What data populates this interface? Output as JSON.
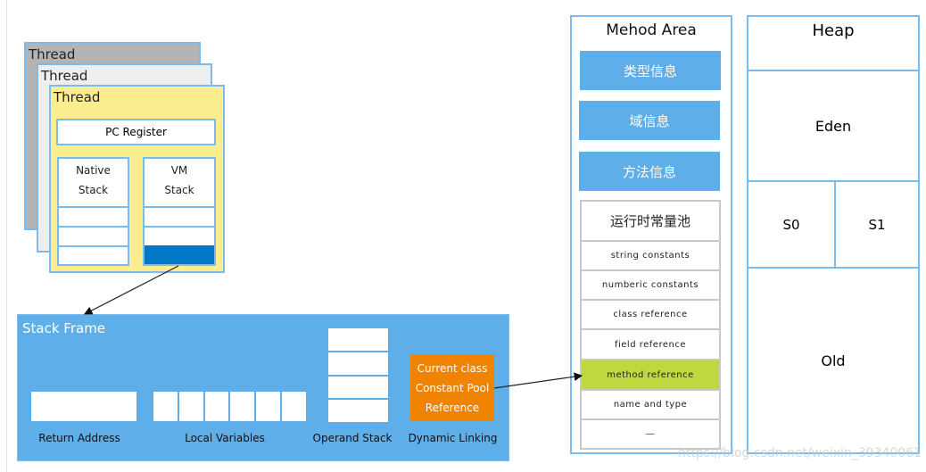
{
  "threads": {
    "labels": [
      "Thread",
      "Thread",
      "Thread"
    ],
    "pc_register": "PC Register",
    "native_stack": [
      "Native",
      "Stack"
    ],
    "vm_stack": [
      "VM",
      "Stack"
    ]
  },
  "stack_frame": {
    "title": "Stack Frame",
    "return_address": "Return Address",
    "local_variables": "Local Variables",
    "operand_stack": "Operand Stack",
    "dynamic_linking": "Dynamic Linking",
    "cp_ref": [
      "Current class",
      "Constant Pool",
      "Reference"
    ]
  },
  "method_area": {
    "title": "Mehod Area",
    "blocks": [
      "类型信息",
      "域信息",
      "方法信息"
    ],
    "pool_title": "运行时常量池",
    "pool_rows": [
      "string constants",
      "numberic constants",
      "class reference",
      "field reference",
      "method reference",
      "name and type",
      "—"
    ]
  },
  "heap": {
    "title": "Heap",
    "eden": "Eden",
    "s0": "S0",
    "s1": "S1",
    "old": "Old"
  },
  "watermark": "https://blog.csdn.net/weixin_39340061",
  "colors": {
    "frame": "#5eaeea",
    "active_slot": "#0078c8",
    "dynamic_link": "#f08300",
    "highlight": "#c0d840",
    "thread_front": "#fbee8e"
  }
}
